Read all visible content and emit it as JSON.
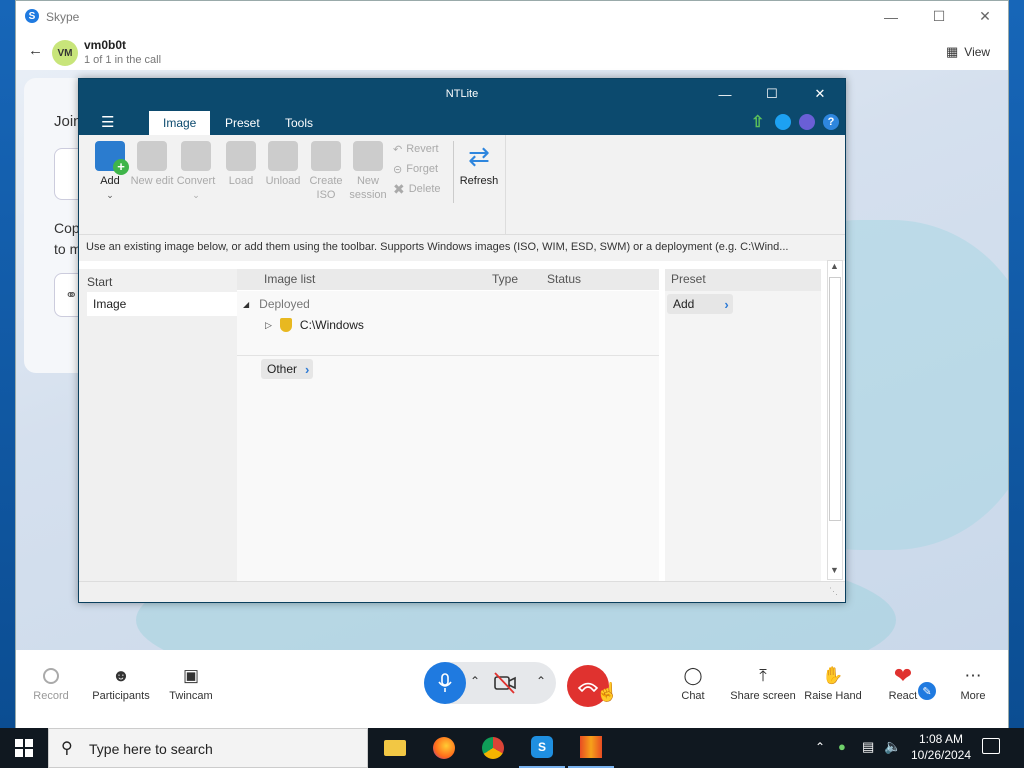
{
  "skype": {
    "title": "Skype",
    "caller_initials": "VM",
    "caller_name": "vm0b0t",
    "caller_sub": "1 of 1 in the call",
    "view_label": "View",
    "join_text": "Joini",
    "copy_text_1": "Copy",
    "copy_text_2": "to m",
    "callbar": {
      "record": "Record",
      "participants": "Participants",
      "twincam": "Twincam",
      "chat": "Chat",
      "share": "Share screen",
      "raise": "Raise Hand",
      "react": "React",
      "more": "More"
    }
  },
  "ntlite": {
    "title": "NTLite",
    "tabs": [
      "Image",
      "Preset",
      "Tools"
    ],
    "toolbar": {
      "add": "Add",
      "new_edit": "New edit",
      "convert": "Convert",
      "load": "Load",
      "unload": "Unload",
      "create_iso": "Create ISO",
      "new_session": "New session",
      "revert": "Revert",
      "forget": "Forget",
      "delete": "Delete",
      "refresh": "Refresh"
    },
    "hint": "Use an existing image below, or add them using the toolbar. Supports Windows images (ISO, WIM, ESD, SWM) or a deployment (e.g. C:\\Wind...",
    "left": {
      "header": "Start",
      "selected": "Image"
    },
    "columns": {
      "list": "Image list",
      "type": "Type",
      "status": "Status",
      "preset": "Preset"
    },
    "tree": {
      "group": "Deployed",
      "item": "C:\\Windows",
      "other": "Other"
    },
    "preset_add": "Add"
  },
  "taskbar": {
    "search_placeholder": "Type here to search",
    "time": "1:08 AM",
    "date": "10/26/2024"
  },
  "colors": {
    "ntlite_blue": "#0c4a6e",
    "skype_blue": "#1f7ae0",
    "hangup_red": "#e0322f"
  }
}
